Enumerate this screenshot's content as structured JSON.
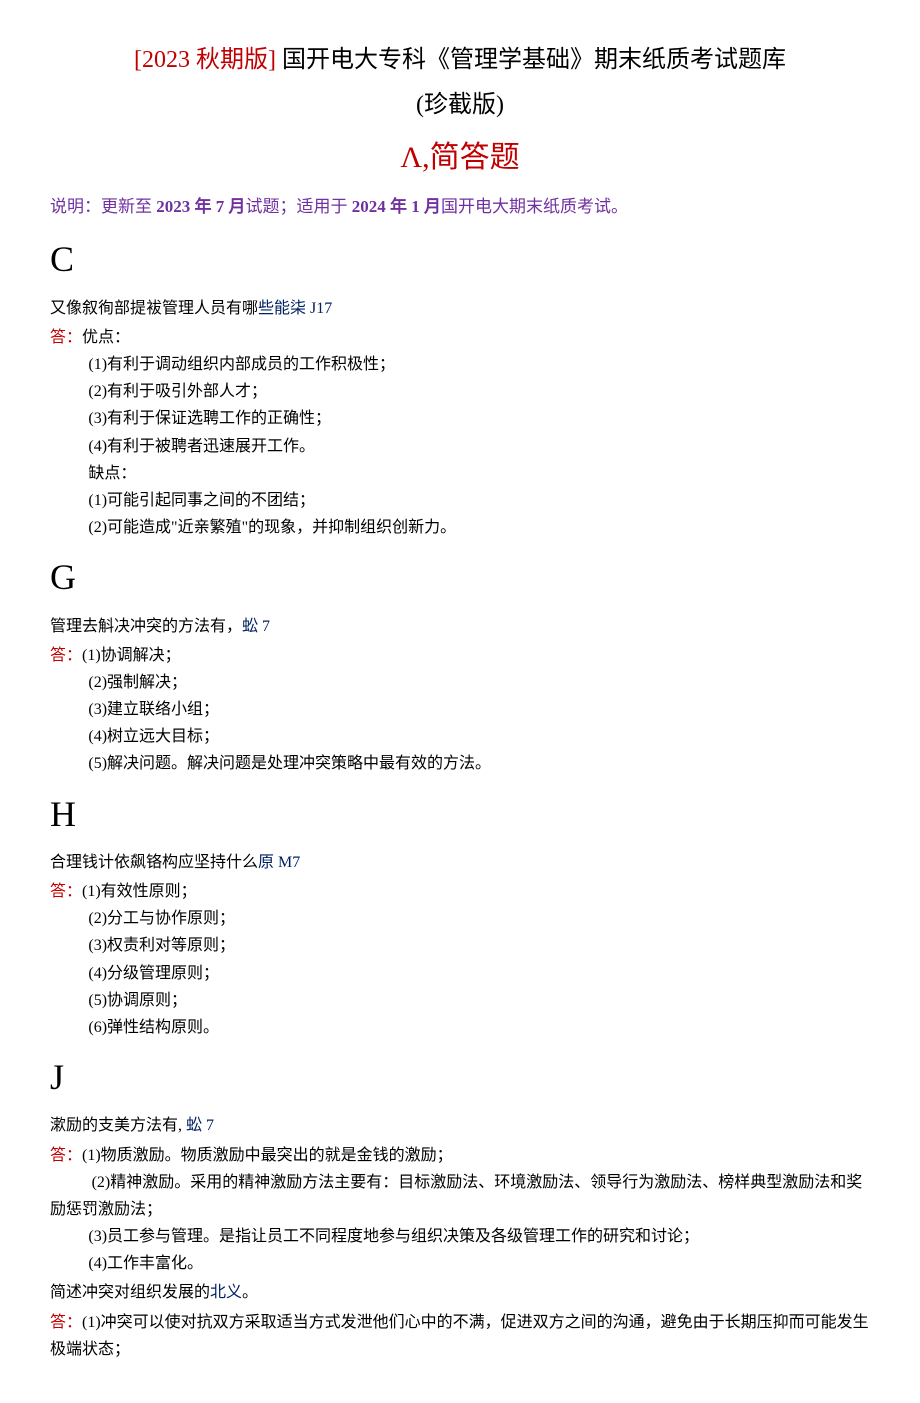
{
  "title": {
    "version_prefix": "[2023 秋期版]",
    "main": "国开电大专科《管理学基础》期末纸质考试题库",
    "sub": "(珍截版)"
  },
  "section_heading": "Λ,简答题",
  "instructions": {
    "prefix": "说明：更新至 ",
    "date1": "2023 年 7 月",
    "mid": "试题；适用于 ",
    "date2": "2024 年 1 月",
    "suffix": "国开电大期末纸质考试。"
  },
  "sections": {
    "C": {
      "letter": "C",
      "q_text": "又像叙徇部提袚管理人员有哪",
      "q_link": "些能柒 J17",
      "answer_label": "答：",
      "advantage_label": "优点：",
      "advantages": [
        "(1)有利于调动组织内部成员的工作积极性；",
        "(2)有利于吸引外部人才；",
        "(3)有利于保证选聘工作的正确性；",
        "(4)有利于被聘者迅速展开工作。"
      ],
      "disadvantage_label": "缺点：",
      "disadvantages": [
        "(1)可能引起同事之间的不团结；",
        "(2)可能造成\"近亲繁殖\"的现象，并抑制组织创新力。"
      ]
    },
    "G": {
      "letter": "G",
      "q_text": "管理去斛决冲突的方法有，",
      "q_link": "蚣 7",
      "answer_label": "答：",
      "items": [
        "(1)协调解决；",
        "(2)强制解决；",
        "(3)建立联络小组；",
        "(4)树立远大目标；",
        "(5)解决问题。解决问题是处理冲突策略中最有效的方法。"
      ]
    },
    "H": {
      "letter": "H",
      "q_text": "合理钱计依飙铬构应坚持什么",
      "q_link": "原 M7",
      "answer_label": "答：",
      "items": [
        "(1)有效性原则；",
        "(2)分工与协作原则；",
        "(3)权责利对等原则；",
        "(4)分级管理原则；",
        "(5)协调原则；",
        "(6)弹性结构原则。"
      ]
    },
    "J": {
      "letter": "J",
      "q1_text": "漱励的支美方法有,",
      "q1_link": " 蚣 7",
      "answer_label": "答：",
      "q1_items": [
        "(1)物质激励。物质激励中最突出的就是金钱的激励；",
        "(2)精神激励。采用的精神激励方法主要有：目标激励法、环境激励法、领导行为激励法、榜样典型激励法和奖励惩罚激励法；",
        "(3)员工参与管理。是指让员工不同程度地参与组织决策及各级管理工作的研究和讨论；",
        "(4)工作丰富化。"
      ],
      "q2_text": "简述冲突对组织发展的",
      "q2_link": "北义",
      "q2_suffix": "。",
      "q2_items": [
        "(1)冲突可以使对抗双方采取适当方式发泄他们心中的不满，促进双方之间的沟通，避免由于长期压抑而可能发生极端状态；"
      ]
    }
  }
}
